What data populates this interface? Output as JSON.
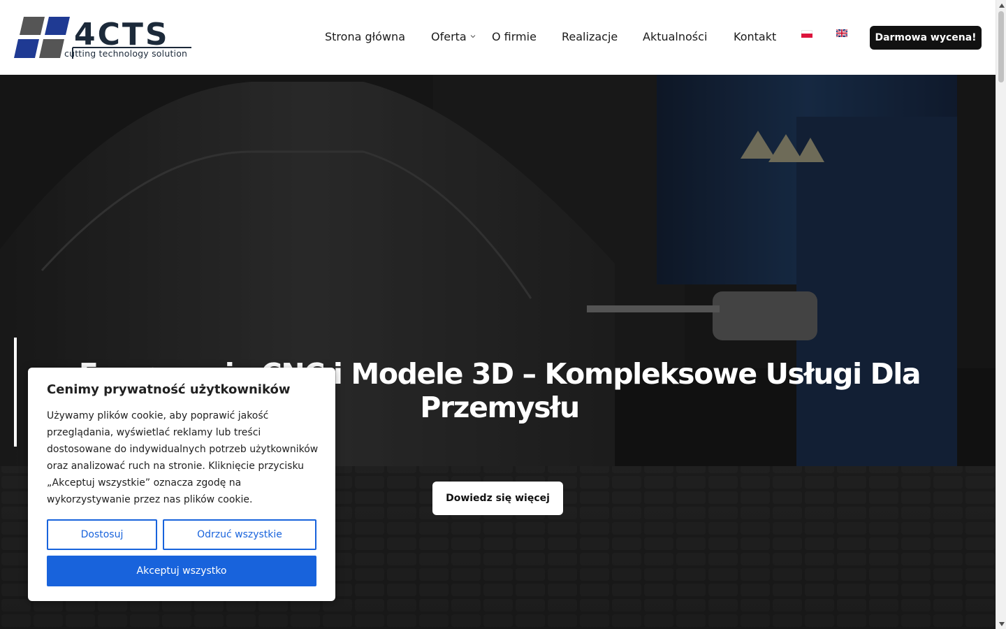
{
  "header": {
    "logo_text": "4CTS",
    "logo_tagline": "cutting technology solution",
    "nav": [
      {
        "label": "Strona główna"
      },
      {
        "label": "Oferta"
      },
      {
        "label": "O firmie"
      },
      {
        "label": "Realizacje"
      },
      {
        "label": "Aktualności"
      },
      {
        "label": "Kontakt"
      }
    ],
    "languages": [
      "pl-flag-icon",
      "en-flag-icon"
    ],
    "cta_label": "Darmowa wycena!"
  },
  "hero": {
    "title": "Frezowanie CNC i Modele 3D – Kompleksowe Usługi Dla Przemysłu",
    "button_label": "Dowiedz się więcej"
  },
  "cookie": {
    "title": "Cenimy prywatność użytkowników",
    "text": "Używamy plików cookie, aby poprawić jakość przeglądania, wyświetlać reklamy lub treści dostosowane do indywidualnych potrzeb użytkowników oraz analizować ruch na stronie. Kliknięcie przycisku „Akceptuj wszystkie” oznacza zgodę na wykorzystywanie przez nas plików cookie.",
    "customize_label": "Dostosuj",
    "reject_label": "Odrzuć wszystkie",
    "accept_label": "Akceptuj wszystko"
  },
  "colors": {
    "logo_blue": "#1f3a93",
    "logo_gray": "#555555",
    "header_cta_bg": "#111111",
    "cookie_accent": "#1863dc",
    "hero_text": "#ffffff"
  }
}
